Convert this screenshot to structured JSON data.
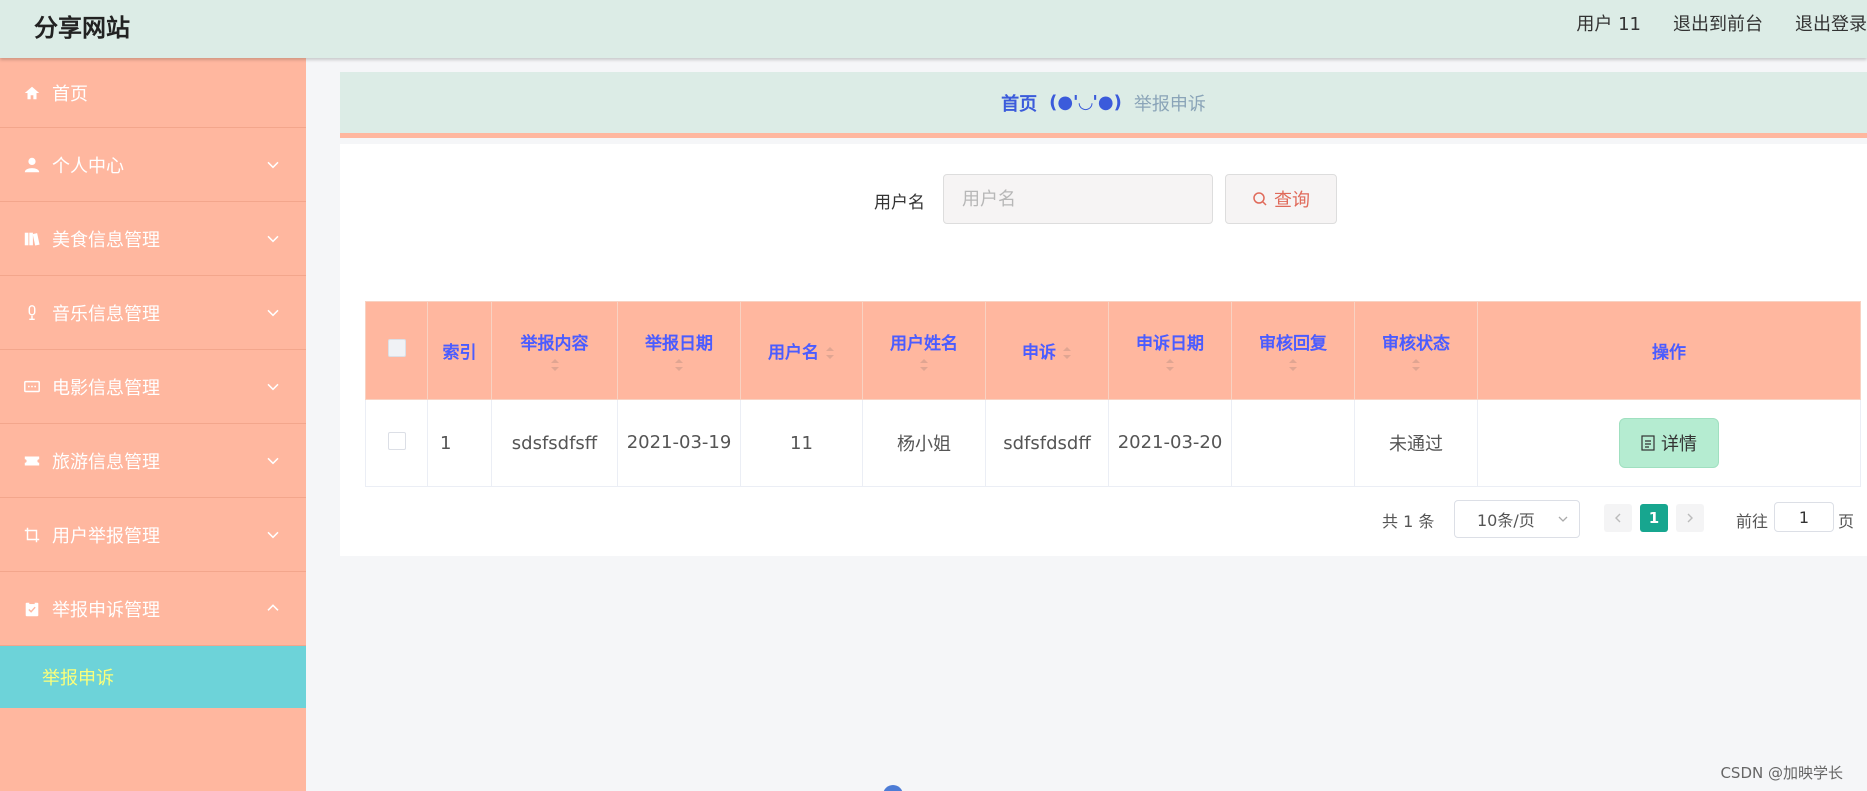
{
  "header": {
    "brand": "分享网站",
    "user": "用户 11",
    "to_front": "退出到前台",
    "logout": "退出登录"
  },
  "sidebar": {
    "items": [
      {
        "label": "首页",
        "icon": "home-icon"
      },
      {
        "label": "个人中心",
        "icon": "user-icon"
      },
      {
        "label": "美食信息管理",
        "icon": "books-icon"
      },
      {
        "label": "音乐信息管理",
        "icon": "microphone-icon"
      },
      {
        "label": "电影信息管理",
        "icon": "chat-icon"
      },
      {
        "label": "旅游信息管理",
        "icon": "ticket-icon"
      },
      {
        "label": "用户举报管理",
        "icon": "crop-icon"
      },
      {
        "label": "举报申诉管理",
        "icon": "clipboard-icon"
      }
    ],
    "active_sub": "举报申诉"
  },
  "breadcrumb": {
    "home": "首页",
    "separator": "(●'◡'●)",
    "current": "举报申诉"
  },
  "search": {
    "label": "用户名",
    "placeholder": "用户名",
    "button": "查询"
  },
  "table": {
    "headers": [
      "索引",
      "举报内容",
      "举报日期",
      "用户名",
      "用户姓名",
      "申诉",
      "申诉日期",
      "审核回复",
      "审核状态",
      "操作"
    ],
    "rows": [
      {
        "index": "1",
        "content": "sdsfsdfsff",
        "report_date": "2021-03-19",
        "username": "11",
        "name": "杨小姐",
        "appeal": "sdfsfdsdff",
        "appeal_date": "2021-03-20",
        "reply": "",
        "status": "未通过",
        "action": "详情"
      }
    ]
  },
  "pagination": {
    "total": "共 1 条",
    "page_size": "10条/页",
    "current_page": "1",
    "goto_label": "前往",
    "goto_value": "1",
    "goto_unit": "页"
  },
  "watermark": "CSDN @加映学长",
  "colors": {
    "header_bg": "#dcece6",
    "sidebar_bg": "#ffb79f",
    "active_sub_bg": "#6dd3d9",
    "table_header_text": "#4b5cff",
    "page_active": "#17a68f"
  }
}
